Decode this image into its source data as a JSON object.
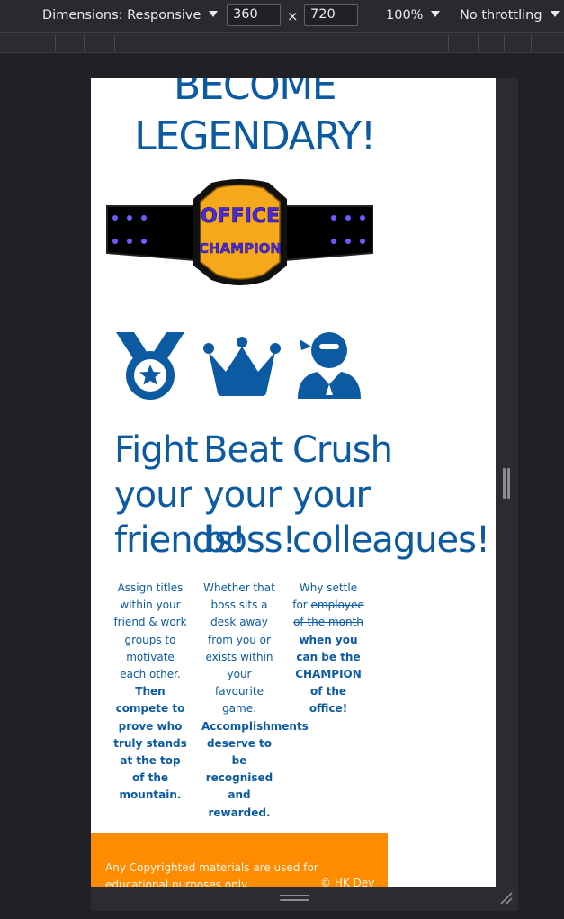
{
  "devtools": {
    "dimensions_label": "Dimensions: Responsive",
    "width_value": "360",
    "times_symbol": "×",
    "height_value": "720",
    "zoom_label": "100%",
    "throttling_label": "No throttling"
  },
  "page": {
    "heading_line1": "BECOME",
    "heading_line2": "LEGENDARY!",
    "belt": {
      "text_top": "OFFICE",
      "text_bottom": "CHAMPION"
    },
    "features": [
      {
        "icon": "medal-icon",
        "title": "Fight\nyour\nfriends!",
        "desc_plain": "Assign titles within your friend & work groups to motivate each other.",
        "desc_bold": "Then compete to prove who truly stands at the top of the mountain."
      },
      {
        "icon": "crown-icon",
        "title": "Beat\nyour\nboss!",
        "desc_plain": "Whether that boss sits a desk away from you or exists within your favourite game.",
        "desc_bold": "Accomplishments deserve to be recognised and rewarded."
      },
      {
        "icon": "ninja-icon",
        "title": "Crush\nyour\ncolleagues!",
        "desc_plain": "Why settle for",
        "desc_strike": "employee of the month",
        "desc_bold": "when you can be the CHAMPION of the office!"
      }
    ],
    "footer": {
      "disclaimer": "Any Copyrighted materials are used for educational purposes only.",
      "copyright": "© HK Dev"
    }
  },
  "colors": {
    "brand_blue": "#0b5aa2",
    "footer_orange": "#ff8c00",
    "belt_gold": "#f6a81d",
    "belt_text_purple": "#4b2bd6"
  }
}
